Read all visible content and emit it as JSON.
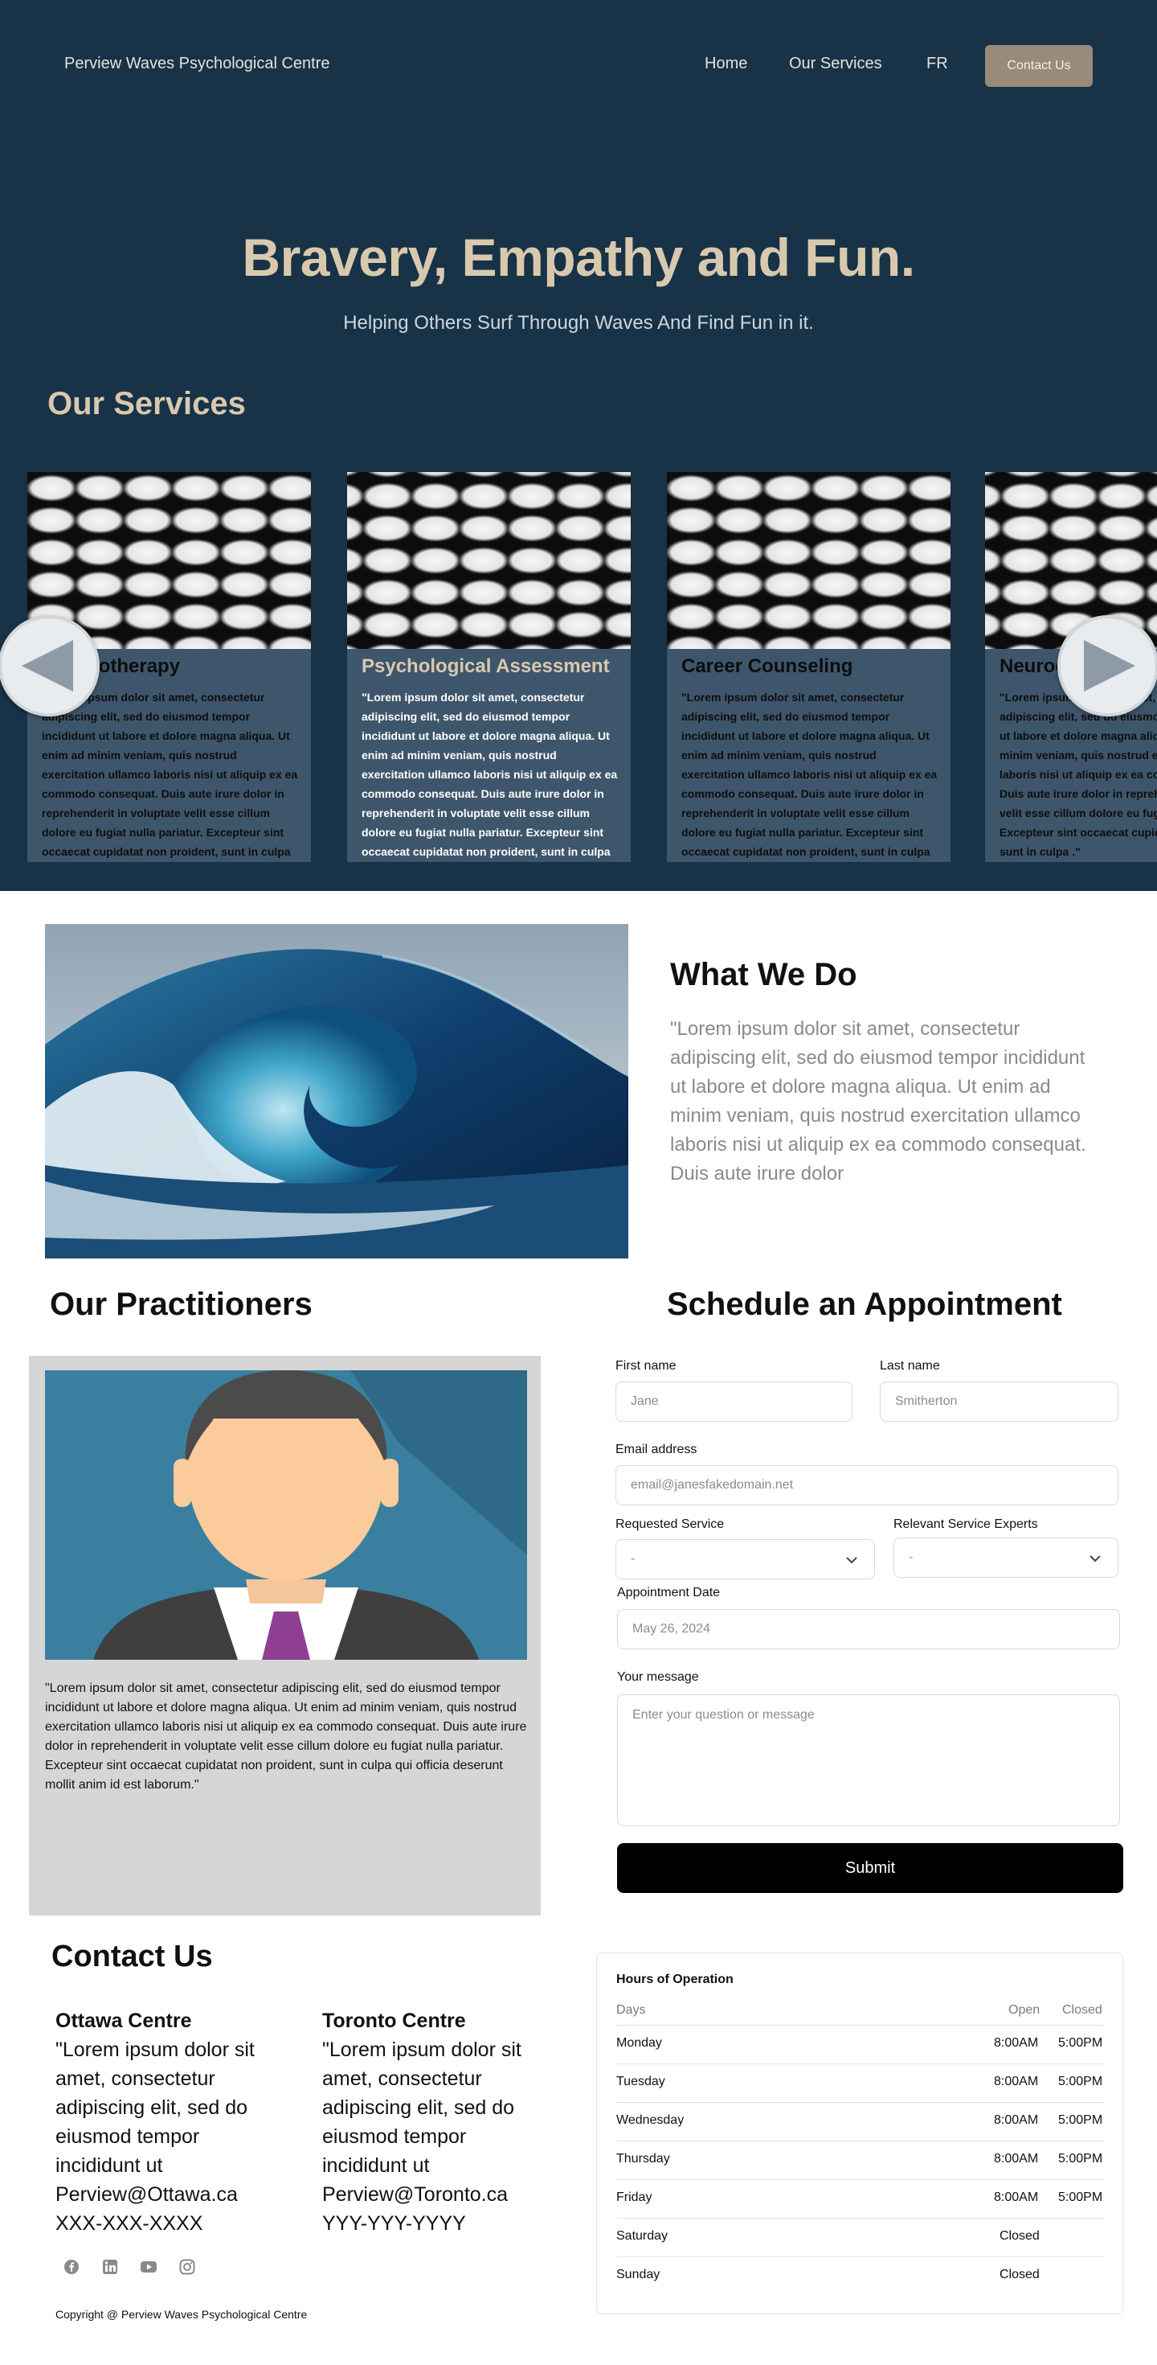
{
  "header": {
    "brand": "Perview Waves Psychological Centre",
    "nav": [
      "Home",
      "Our Services",
      "FR"
    ],
    "contact_button": "Contact Us"
  },
  "hero": {
    "title": "Bravery, Empathy and Fun.",
    "subtitle": "Helping Others Surf Through Waves And Find Fun in it."
  },
  "services": {
    "heading": "Our Services",
    "cards": [
      {
        "title": "Psychotherapy",
        "body": "\"Lorem ipsum dolor sit amet, consectetur adipiscing elit, sed do eiusmod tempor incididunt ut labore et dolore magna aliqua. Ut enim ad minim veniam, quis nostrud exercitation ullamco laboris nisi ut aliquip ex ea commodo consequat. Duis aute irure dolor in reprehenderit in voluptate velit esse cillum dolore eu fugiat nulla pariatur. Excepteur sint occaecat cupidatat non proident, sunt in culpa .\""
      },
      {
        "title": "Psychological Assessment",
        "body": "\"Lorem ipsum dolor sit amet, consectetur adipiscing elit, sed do eiusmod tempor incididunt ut labore et dolore magna aliqua. Ut enim ad minim veniam, quis nostrud exercitation ullamco laboris nisi ut aliquip ex ea commodo consequat. Duis aute irure dolor in reprehenderit in voluptate velit esse cillum dolore eu fugiat nulla pariatur. Excepteur sint occaecat cupidatat non proident, sunt in culpa .\""
      },
      {
        "title": "Career Counseling",
        "body": "\"Lorem ipsum dolor sit amet, consectetur adipiscing elit, sed do eiusmod tempor incididunt ut labore et dolore magna aliqua. Ut enim ad minim veniam, quis nostrud exercitation ullamco laboris nisi ut aliquip ex ea commodo consequat. Duis aute irure dolor in reprehenderit in voluptate velit esse cillum dolore eu fugiat nulla pariatur. Excepteur sint occaecat cupidatat non proident, sunt in culpa .\""
      },
      {
        "title": "Neurodiversity",
        "body": "\"Lorem ipsum dolor sit amet, consectetur adipiscing elit, sed do eiusmod tempor incididunt ut labore et dolore magna aliqua. Ut enim ad minim veniam, quis nostrud exercitation ullamco laboris nisi ut aliquip ex ea commodo consequat. Duis aute irure dolor in reprehenderit in voluptate velit esse cillum dolore eu fugiat nulla pariatur. Excepteur sint occaecat cupidatat non proident, sunt in culpa .\""
      }
    ]
  },
  "what_we_do": {
    "title": "What We Do",
    "text": "\"Lorem ipsum dolor sit amet, consectetur adipiscing elit, sed do eiusmod tempor incididunt ut labore et dolore magna aliqua. Ut enim ad minim veniam, quis nostrud exercitation ullamco laboris nisi ut aliquip ex ea commodo consequat. Duis aute irure dolor"
  },
  "practitioners": {
    "title": "Our Practitioners",
    "bio": "\"Lorem ipsum dolor sit amet, consectetur adipiscing elit, sed do eiusmod tempor incididunt ut labore et dolore magna aliqua. Ut enim ad minim veniam, quis nostrud exercitation ullamco laboris nisi ut aliquip ex ea commodo consequat. Duis aute irure dolor in reprehenderit in voluptate velit esse cillum dolore eu fugiat nulla pariatur. Excepteur sint occaecat cupidatat non proident, sunt in culpa qui officia deserunt mollit anim id est laborum.\""
  },
  "appointment": {
    "title": "Schedule an Appointment",
    "first_name_label": "First name",
    "first_name_placeholder": "Jane",
    "last_name_label": "Last name",
    "last_name_placeholder": "Smitherton",
    "email_label": "Email address",
    "email_placeholder": "email@janesfakedomain.net",
    "service_label": "Requested Service",
    "service_value": "-",
    "expert_label": "Relevant Service Experts",
    "expert_value": "-",
    "date_label": "Appointment Date",
    "date_value": "May 26, 2024",
    "message_label": "Your message",
    "message_placeholder": "Enter your question or message",
    "submit_label": "Submit"
  },
  "contact": {
    "title": "Contact Us",
    "centres": [
      {
        "name": "Ottawa Centre",
        "text": "\"Lorem ipsum dolor sit amet, consectetur adipiscing elit, sed do eiusmod tempor incididunt ut",
        "email": "Perview@Ottawa.ca",
        "phone": "XXX-XXX-XXXX"
      },
      {
        "name": "Toronto Centre",
        "text": "\"Lorem ipsum dolor sit amet, consectetur adipiscing elit, sed do eiusmod tempor incididunt ut",
        "email": "Perview@Toronto.ca",
        "phone": "YYY-YYY-YYYY"
      }
    ],
    "social_icons": [
      "facebook-icon",
      "linkedin-icon",
      "youtube-icon",
      "instagram-icon"
    ],
    "copyright": "Copyright @ Perview Waves Psychological Centre"
  },
  "hours": {
    "title": "Hours of Operation",
    "columns": [
      "Days",
      "Open",
      "Closed"
    ],
    "rows": [
      {
        "day": "Monday",
        "open": "8:00AM",
        "close": "5:00PM"
      },
      {
        "day": "Tuesday",
        "open": "8:00AM",
        "close": "5:00PM"
      },
      {
        "day": "Wednesday",
        "open": "8:00AM",
        "close": "5:00PM"
      },
      {
        "day": "Thursday",
        "open": "8:00AM",
        "close": "5:00PM"
      },
      {
        "day": "Friday",
        "open": "8:00AM",
        "close": "5:00PM"
      },
      {
        "day": "Saturday",
        "status": "Closed"
      },
      {
        "day": "Sunday",
        "status": "Closed"
      }
    ]
  },
  "colors": {
    "hero_bg": "#183247",
    "accent_tan": "#d8c9ae",
    "card_bg": "#3e566b",
    "button_tan": "#9a8a7a"
  }
}
